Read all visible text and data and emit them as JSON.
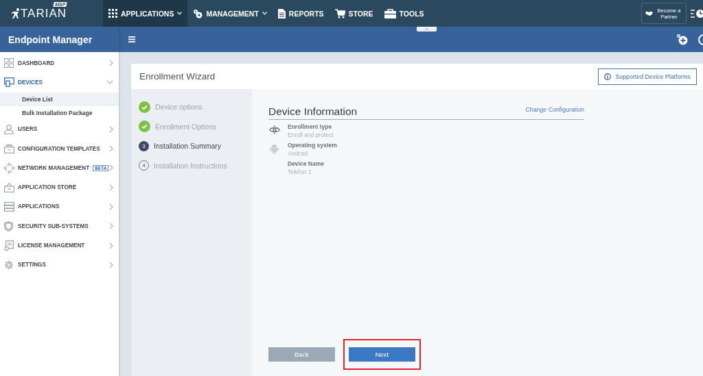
{
  "logo": {
    "name": "TARIAN",
    "badge": "MSP"
  },
  "top_menu": [
    {
      "label": "APPLICATIONS",
      "dropdown": true,
      "selected": true
    },
    {
      "label": "MANAGEMENT",
      "dropdown": true,
      "selected": false
    },
    {
      "label": "REPORTS",
      "dropdown": false,
      "selected": false
    },
    {
      "label": "STORE",
      "dropdown": false,
      "selected": false
    },
    {
      "label": "TOOLS",
      "dropdown": false,
      "selected": false
    }
  ],
  "partner_button": {
    "label": "Become a Partner"
  },
  "module_title": "Endpoint Manager",
  "sidebar": {
    "items": [
      {
        "label": "DASHBOARD",
        "expanded": false,
        "selected": false
      },
      {
        "label": "DEVICES",
        "expanded": true,
        "selected": true,
        "children": [
          {
            "label": "Device List",
            "selected": true
          },
          {
            "label": "Bulk Installation Package",
            "selected": false
          }
        ]
      },
      {
        "label": "USERS",
        "expanded": false,
        "selected": false
      },
      {
        "label": "CONFIGURATION TEMPLATES",
        "expanded": false,
        "selected": false
      },
      {
        "label": "NETWORK MANAGEMENT",
        "badge": "BETA",
        "expanded": false,
        "selected": false
      },
      {
        "label": "APPLICATION STORE",
        "expanded": false,
        "selected": false
      },
      {
        "label": "APPLICATIONS",
        "expanded": false,
        "selected": false
      },
      {
        "label": "SECURITY SUB-SYSTEMS",
        "expanded": false,
        "selected": false
      },
      {
        "label": "LICENSE MANAGEMENT",
        "expanded": false,
        "selected": false
      },
      {
        "label": "SETTINGS",
        "expanded": false,
        "selected": false
      }
    ]
  },
  "wizard": {
    "title": "Enrollment Wizard",
    "platforms_button": "Supported Device Platforms",
    "steps": [
      {
        "label": "Device options",
        "kind": "done"
      },
      {
        "label": "Enrollment Options",
        "kind": "done"
      },
      {
        "number": "3",
        "label": "Installation Summary",
        "kind": "current"
      },
      {
        "number": "4",
        "label": "Installation Instructions",
        "kind": "pending"
      }
    ],
    "section_title": "Device Information",
    "change_link": "Change Configuration",
    "fields": [
      {
        "label": "Enrollment type",
        "value": "Enroll and protect"
      },
      {
        "label": "Operating system",
        "value": "Android"
      },
      {
        "label": "Device Name",
        "value": "Telefon 1"
      }
    ],
    "buttons": [
      {
        "label": "Back",
        "kind": "secondary",
        "highlighted": false
      },
      {
        "label": "Next",
        "kind": "primary",
        "highlighted": true
      }
    ]
  }
}
